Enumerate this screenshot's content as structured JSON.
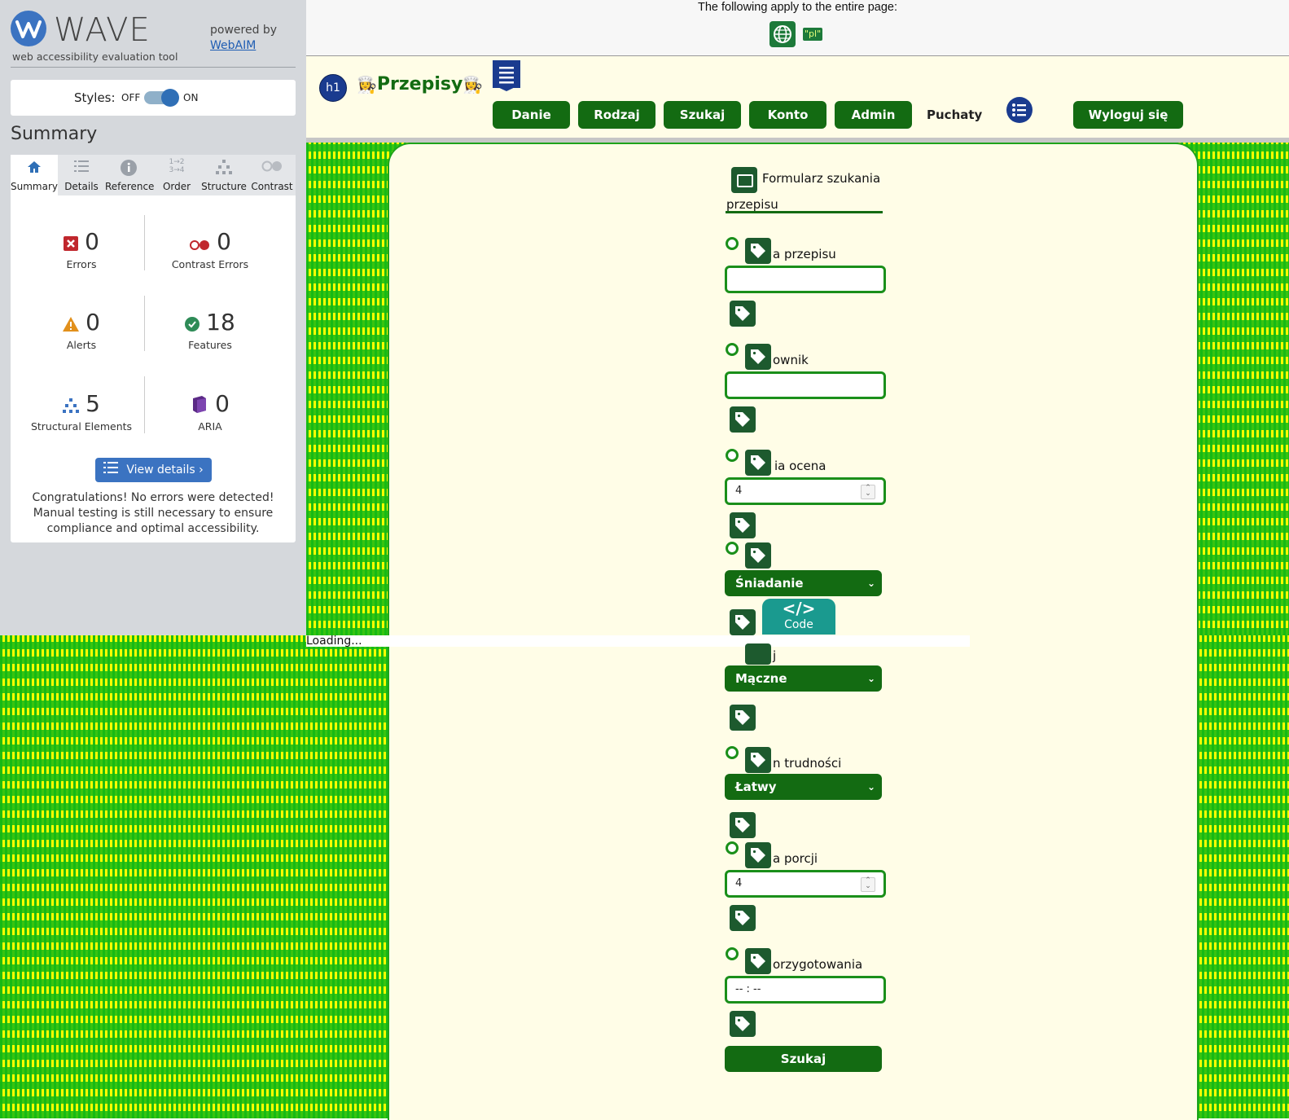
{
  "wave": {
    "title": "WAVE",
    "subtitle": "web accessibility evaluation tool",
    "powered_by": "powered by",
    "webaim_link": "WebAIM",
    "styles_label": "Styles:",
    "styles_off": "OFF",
    "styles_on": "ON",
    "summary_heading": "Summary",
    "tabs": [
      {
        "label": "Summary",
        "icon": "home-icon"
      },
      {
        "label": "Details",
        "icon": "list-icon"
      },
      {
        "label": "Reference",
        "icon": "info-icon"
      },
      {
        "label": "Order",
        "icon": "order-icon"
      },
      {
        "label": "Structure",
        "icon": "structure-icon"
      },
      {
        "label": "Contrast",
        "icon": "contrast-icon"
      }
    ],
    "stats": {
      "errors": {
        "value": "0",
        "label": "Errors"
      },
      "contrast_errors": {
        "value": "0",
        "label": "Contrast Errors"
      },
      "alerts": {
        "value": "0",
        "label": "Alerts"
      },
      "features": {
        "value": "18",
        "label": "Features"
      },
      "structural": {
        "value": "5",
        "label": "Structural Elements"
      },
      "aria": {
        "value": "0",
        "label": "ARIA"
      }
    },
    "view_details": "View details ›",
    "congrats": "Congratulations! No errors were detected! Manual testing is still necessary to ensure compliance and optimal accessibility.",
    "colors": {
      "accent": "#3b73c1",
      "error": "#c0272d",
      "alert": "#e2901c",
      "feature": "#2e8b57",
      "aria": "#5b2a86"
    }
  },
  "pagebar": {
    "text": "The following apply to the entire page:",
    "lang_tag": "\"pl\""
  },
  "site": {
    "title": "Przepisy",
    "h1_badge": "h1",
    "nav": [
      "Danie",
      "Rodzaj",
      "Szukaj",
      "Konto",
      "Admin"
    ],
    "nav_plain": "Puchaty",
    "logout": "Wyloguj się",
    "colors": {
      "brand": "#136b12",
      "background": "#fffde7"
    }
  },
  "form": {
    "legend_line1": "Formularz szukania",
    "legend_line2": "przepisu",
    "fields": {
      "name_label": "a przepisu",
      "user_label": "ownik",
      "rating_label": "ia ocena",
      "rating_value": "4",
      "meal_value": "Śniadanie",
      "type_label": "j",
      "type_value": "Mączne",
      "difficulty_label": "n trudności",
      "difficulty_value": "Łatwy",
      "portions_label": "a porcji",
      "portions_value": "4",
      "time_label": "orzygotowania",
      "time_value": "-- : --"
    },
    "submit": "Szukaj",
    "code_badge": "Code",
    "loading": "Loading..."
  }
}
